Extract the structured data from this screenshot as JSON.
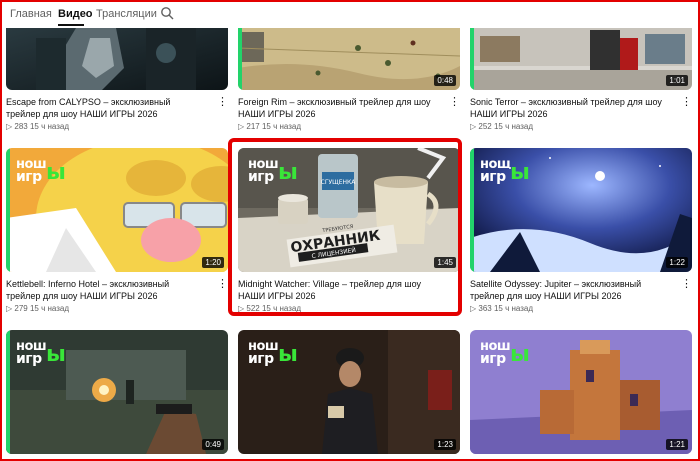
{
  "nav": {
    "tabs": [
      {
        "label": "Главная"
      },
      {
        "label": "Видео"
      },
      {
        "label": "Трансляции"
      }
    ],
    "search_icon": "search-icon"
  },
  "videos": [
    {
      "title": "Escape from CALYPSO – эксклюзивный трейлер для шоу НАШИ ИГРЫ 2026",
      "views": "▷ 283",
      "age": "15 ч назад",
      "duration": ""
    },
    {
      "title": "Foreign Rim – эксклюзивный трейлер для шоу НАШИ ИГРЫ 2026",
      "views": "▷ 217",
      "age": "15 ч назад",
      "duration": "0:48"
    },
    {
      "title": "Sonic Terror – эксклюзивный трейлер для шоу НАШИ ИГРЫ 2026",
      "views": "▷ 252",
      "age": "15 ч назад",
      "duration": "1:01"
    },
    {
      "title": "Kettlebell: Inferno Hotel – эксклюзивный трейлер для шоу НАШИ ИГРЫ 2026",
      "views": "▷ 279",
      "age": "15 ч назад",
      "duration": "1:20"
    },
    {
      "title": "Midnight Watcher: Village – трейлер для шоу НАШИ ИГРЫ 2026",
      "views": "▷ 522",
      "age": "15 ч назад",
      "duration": "1:45"
    },
    {
      "title": "Satellite Odyssey: Jupiter – эксклюзивный трейлер для шоу НАШИ ИГРЫ 2026",
      "views": "▷ 363",
      "age": "15 ч назад",
      "duration": "1:22"
    },
    {
      "title": "",
      "views": "",
      "age": "",
      "duration": "0:49"
    },
    {
      "title": "",
      "views": "",
      "age": "",
      "duration": "1:23"
    },
    {
      "title": "",
      "views": "",
      "age": "",
      "duration": "1:21"
    }
  ],
  "thumb_logo": {
    "w1": "нош",
    "w2": "игр",
    "w3": "ы"
  },
  "thumb_text": {
    "okhrannik": "ОХРАННИК",
    "licensed": "С ЛИЦЕНЗИЕЙ",
    "required": "ТРЕБУЮТСЯ",
    "can_label": "СГУЩЕНКА"
  },
  "more_icon": "⋮",
  "colors": {
    "accent": "#e30000",
    "progress": "#22d36a",
    "logo_green": "#39e639"
  }
}
